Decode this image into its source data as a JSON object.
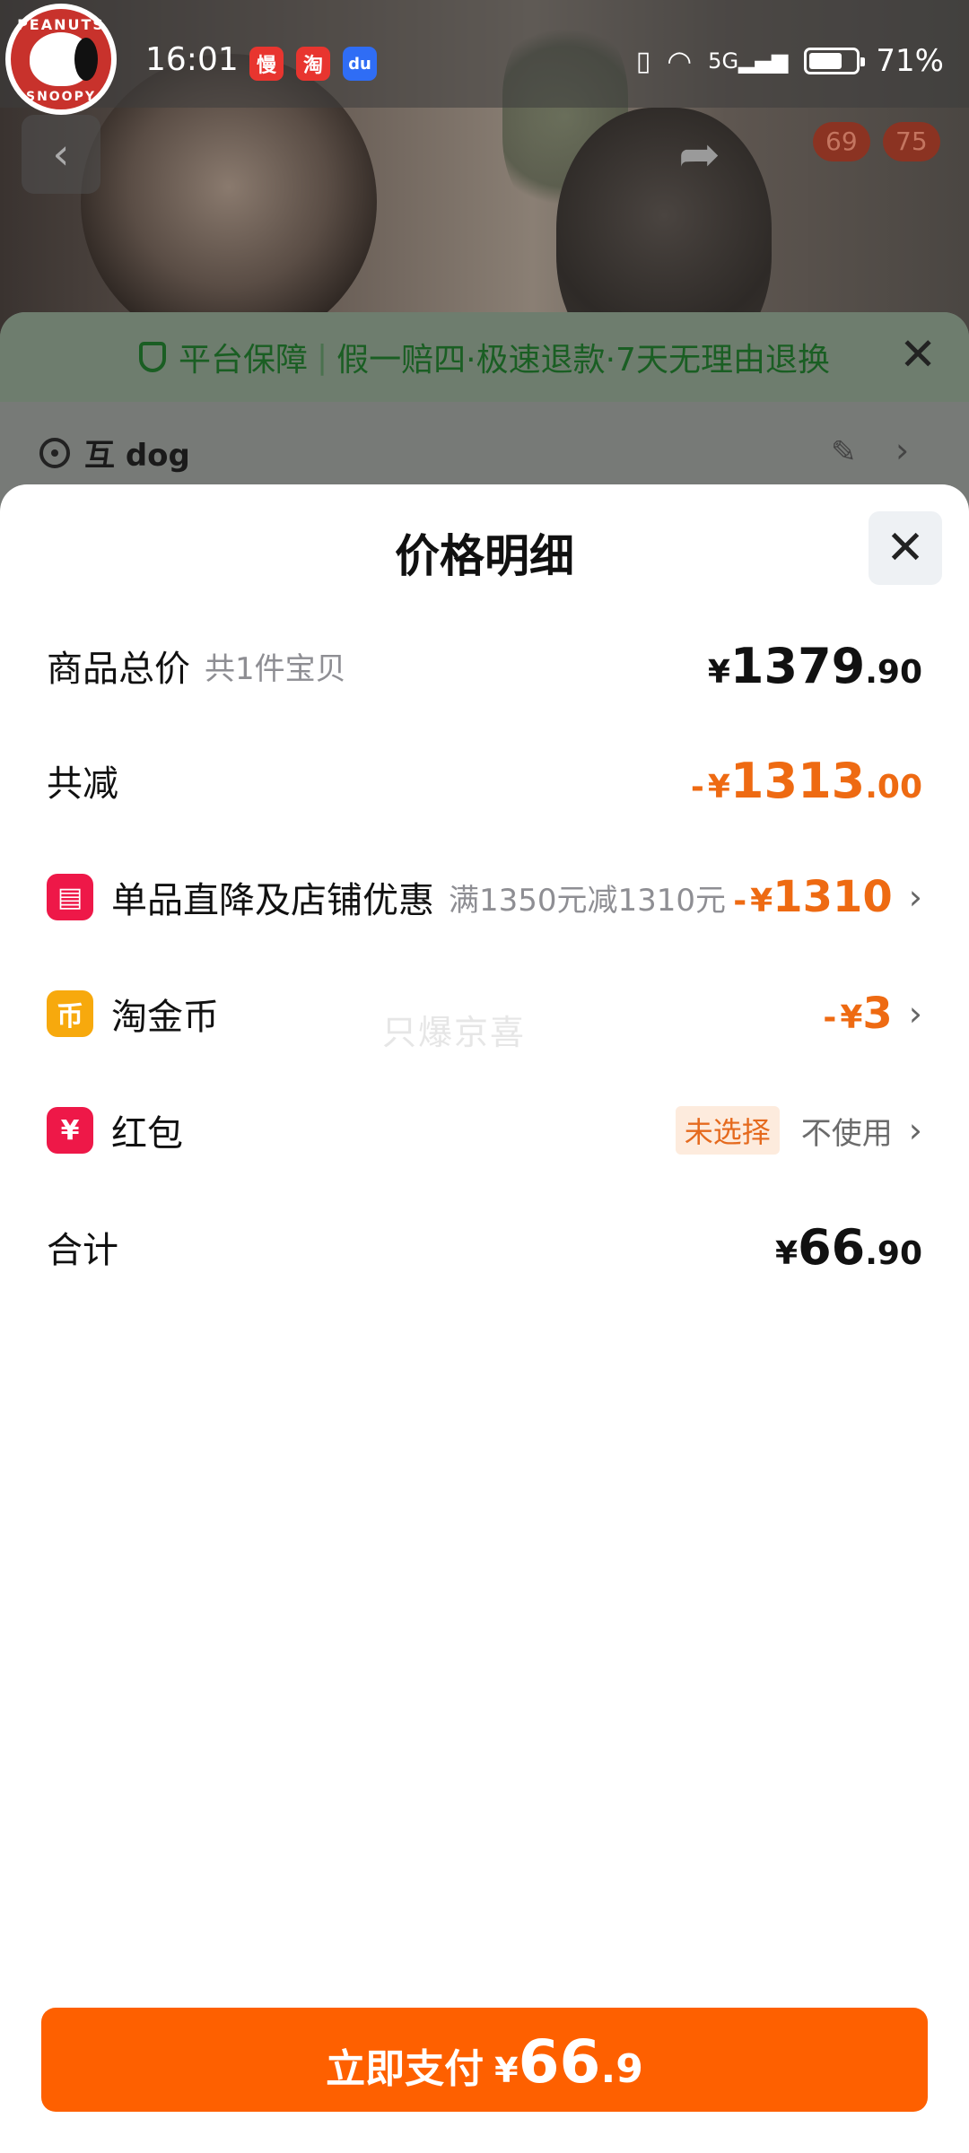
{
  "status_bar": {
    "time": "16:01",
    "battery": "71%",
    "network": "5G",
    "apps": [
      {
        "icon": "manman-app-icon",
        "glyph": "慢",
        "color": "#e8352f"
      },
      {
        "icon": "taobao-app-icon",
        "glyph": "淘",
        "color": "#e8352f"
      },
      {
        "icon": "baidu-app-icon",
        "glyph": "du",
        "color": "#2f6df5"
      }
    ]
  },
  "logo": {
    "top_text": "PEANUTS",
    "bottom_text": "SNOOPY"
  },
  "background_page": {
    "cart_badges": [
      "69",
      "75"
    ],
    "guarantee": {
      "title": "平台保障",
      "items": "假一赔四·极速退款·7天无理由退换"
    },
    "address": "互 dog"
  },
  "sheet": {
    "title": "价格明细",
    "rows": {
      "total": {
        "label": "商品总价",
        "sub": "共1件宝贝",
        "currency": "¥",
        "int": "1379",
        "dec": ".90"
      },
      "reduce": {
        "label": "共减",
        "prefix": "-",
        "currency": "¥",
        "int": "1313",
        "dec": ".00"
      },
      "discount": {
        "label": "单品直降及店铺优惠",
        "sub": "满1350元减1310元",
        "prefix": "-",
        "currency": "¥",
        "int": "1310"
      },
      "coin": {
        "label": "淘金币",
        "prefix": "-",
        "currency": "¥",
        "int": "3"
      },
      "redpacket": {
        "label": "红包",
        "tag": "未选择",
        "value": "不使用"
      },
      "sum": {
        "label": "合计",
        "currency": "¥",
        "int": "66",
        "dec": ".90"
      }
    },
    "watermark": "只爆京喜"
  },
  "pay_button": {
    "label": "立即支付",
    "currency": "¥",
    "int": "66",
    "dec": ".9"
  },
  "colors": {
    "accent": "#fe6000",
    "discount": "#ee6a12",
    "guarantee_green": "#1a5e23"
  }
}
